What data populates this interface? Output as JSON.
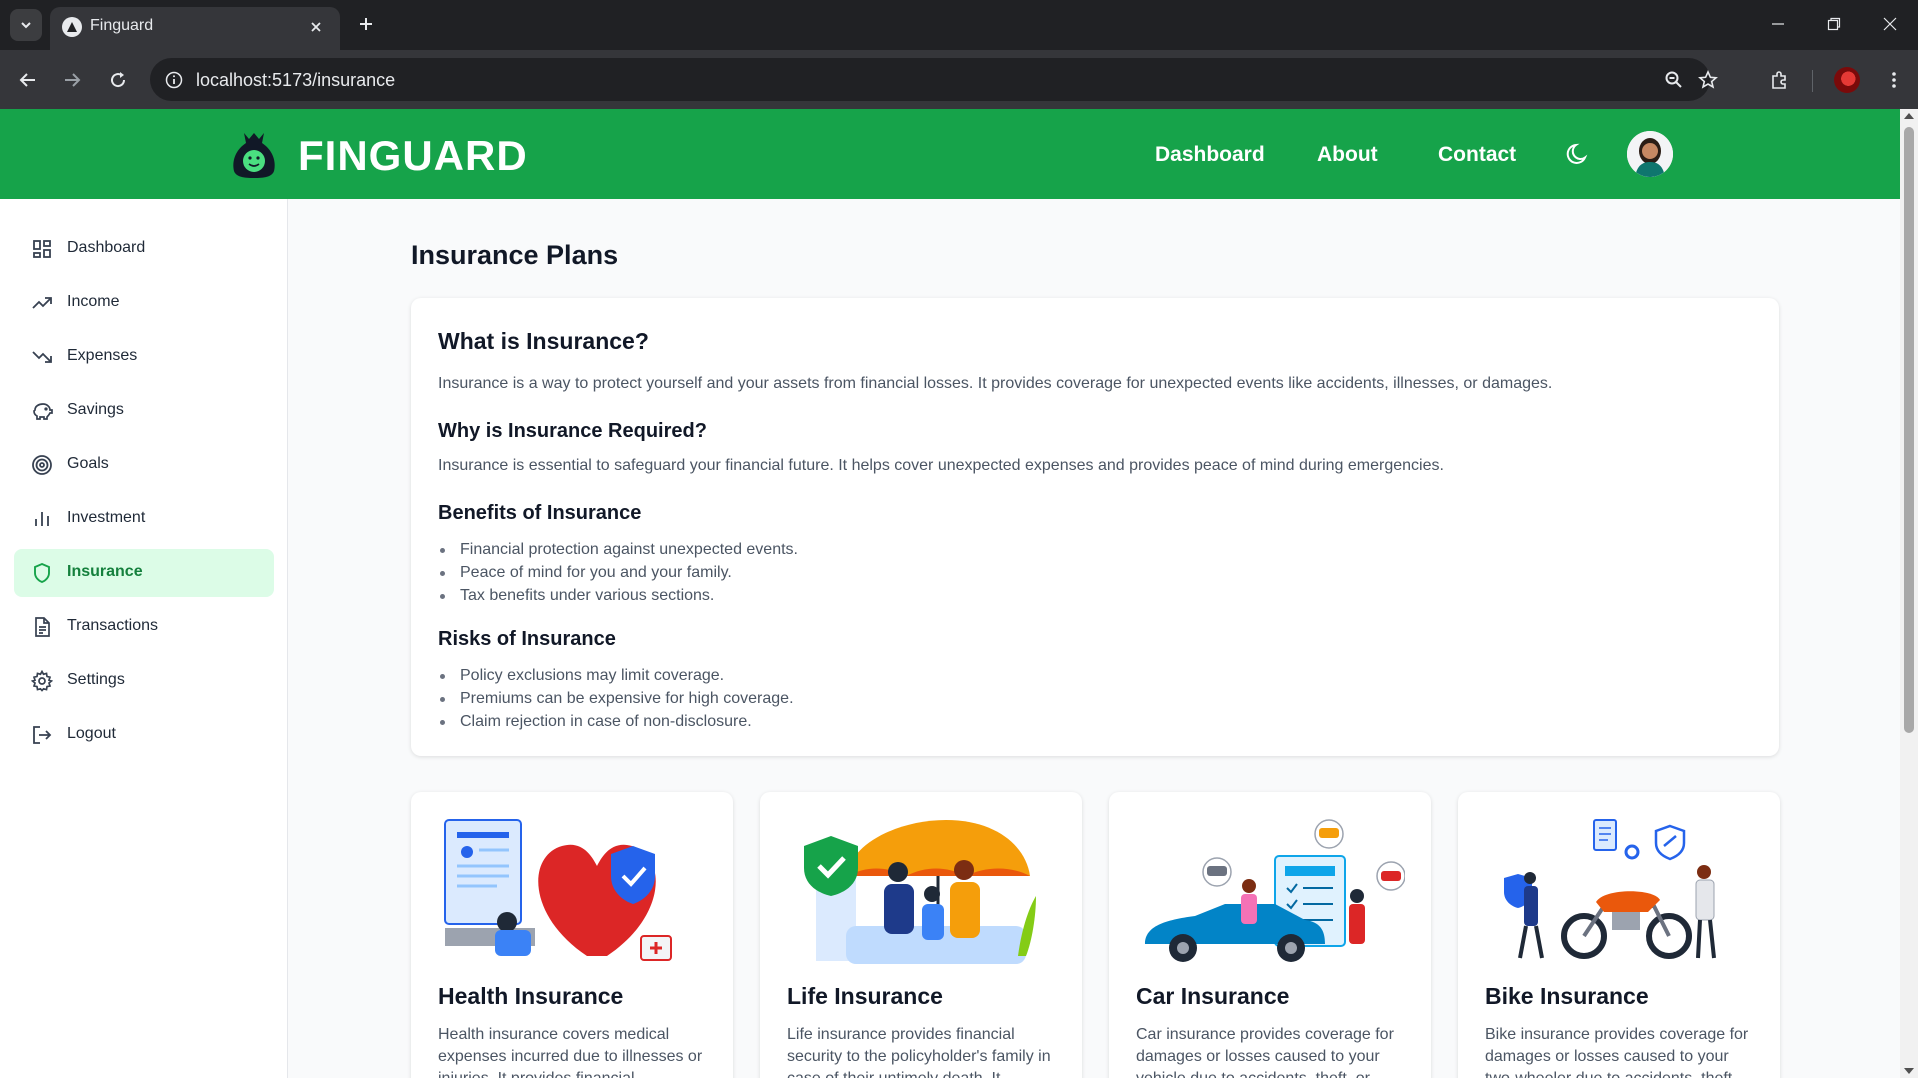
{
  "browser": {
    "tab_title": "Finguard",
    "url": "localhost:5173/insurance"
  },
  "header": {
    "brand": "FINGUARD",
    "nav": [
      "Dashboard",
      "About",
      "Contact"
    ],
    "accent_color": "#16a34a"
  },
  "sidebar": {
    "items": [
      {
        "label": "Dashboard",
        "icon": "grid-icon"
      },
      {
        "label": "Income",
        "icon": "trending-up-icon"
      },
      {
        "label": "Expenses",
        "icon": "trending-down-icon"
      },
      {
        "label": "Savings",
        "icon": "piggy-bank-icon"
      },
      {
        "label": "Goals",
        "icon": "target-icon"
      },
      {
        "label": "Investment",
        "icon": "bar-chart-icon"
      },
      {
        "label": "Insurance",
        "icon": "shield-icon",
        "active": true
      },
      {
        "label": "Transactions",
        "icon": "file-text-icon"
      },
      {
        "label": "Settings",
        "icon": "gear-icon"
      },
      {
        "label": "Logout",
        "icon": "logout-icon"
      }
    ]
  },
  "main": {
    "title": "Insurance Plans",
    "info": {
      "what_heading": "What is Insurance?",
      "what_text": "Insurance is a way to protect yourself and your assets from financial losses. It provides coverage for unexpected events like accidents, illnesses, or damages.",
      "why_heading": "Why is Insurance Required?",
      "why_text": "Insurance is essential to safeguard your financial future. It helps cover unexpected expenses and provides peace of mind during emergencies.",
      "benefits_heading": "Benefits of Insurance",
      "benefits": [
        "Financial protection against unexpected events.",
        "Peace of mind for you and your family.",
        "Tax benefits under various sections."
      ],
      "risks_heading": "Risks of Insurance",
      "risks": [
        "Policy exclusions may limit coverage.",
        "Premiums can be expensive for high coverage.",
        "Claim rejection in case of non-disclosure."
      ]
    },
    "plans": [
      {
        "title": "Health Insurance",
        "desc": "Health insurance covers medical expenses incurred due to illnesses or injuries. It provides financial"
      },
      {
        "title": "Life Insurance",
        "desc": "Life insurance provides financial security to the policyholder's family in case of their untimely death. It"
      },
      {
        "title": "Car Insurance",
        "desc": "Car insurance provides coverage for damages or losses caused to your vehicle due to accidents, theft, or"
      },
      {
        "title": "Bike Insurance",
        "desc": "Bike insurance provides coverage for damages or losses caused to your two-wheeler due to accidents, theft"
      }
    ]
  }
}
